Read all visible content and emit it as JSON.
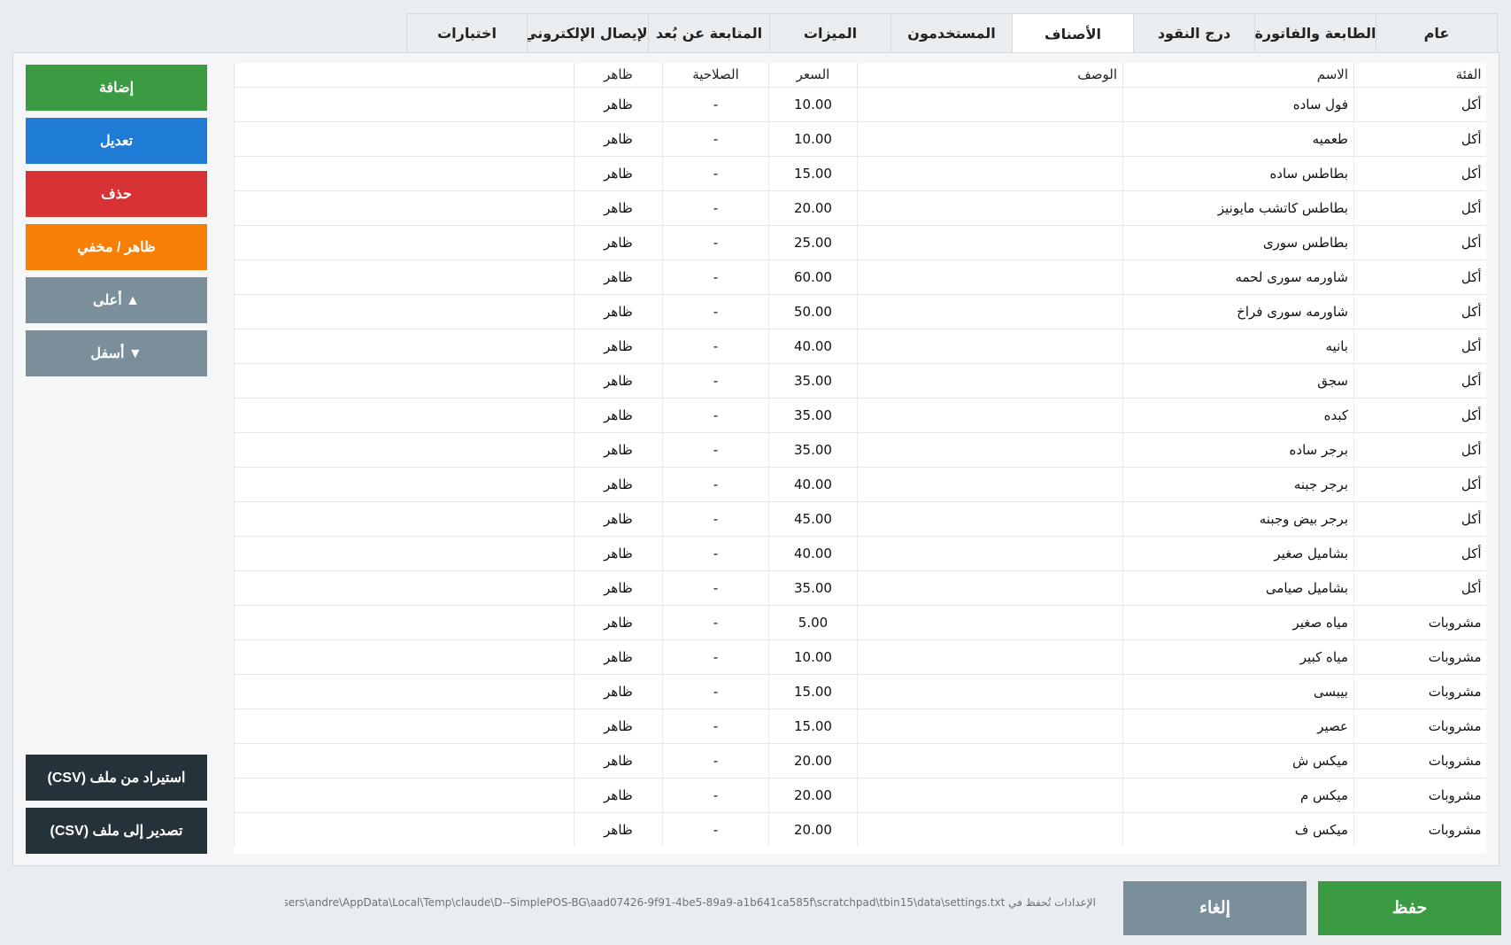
{
  "tabs": [
    {
      "label": "عام",
      "active": false
    },
    {
      "label": "الطابعة والفاتورة",
      "active": false
    },
    {
      "label": "درج النقود",
      "active": false
    },
    {
      "label": "الأصناف",
      "active": true
    },
    {
      "label": "المستخدمون",
      "active": false
    },
    {
      "label": "الميزات",
      "active": false
    },
    {
      "label": "المتابعة عن بُعد",
      "active": false
    },
    {
      "label": "الإيصال الإلكتروني",
      "active": false
    },
    {
      "label": "اختبارات",
      "active": false
    }
  ],
  "table": {
    "headers": {
      "category": "الفئة",
      "name": "الاسم",
      "description": "الوصف",
      "price": "السعر",
      "expiry": "الصلاحية",
      "visibility": "ظاهر"
    },
    "rows": [
      {
        "category": "أكل",
        "name": "فول ساده",
        "description": "",
        "price": "10.00",
        "expiry": "-",
        "visibility": "ظاهر"
      },
      {
        "category": "أكل",
        "name": "طعميه",
        "description": "",
        "price": "10.00",
        "expiry": "-",
        "visibility": "ظاهر"
      },
      {
        "category": "أكل",
        "name": "بطاطس ساده",
        "description": "",
        "price": "15.00",
        "expiry": "-",
        "visibility": "ظاهر"
      },
      {
        "category": "أكل",
        "name": "بطاطس كاتشب مايونيز",
        "description": "",
        "price": "20.00",
        "expiry": "-",
        "visibility": "ظاهر"
      },
      {
        "category": "أكل",
        "name": "بطاطس سورى",
        "description": "",
        "price": "25.00",
        "expiry": "-",
        "visibility": "ظاهر"
      },
      {
        "category": "أكل",
        "name": "شاورمه سورى لحمه",
        "description": "",
        "price": "60.00",
        "expiry": "-",
        "visibility": "ظاهر"
      },
      {
        "category": "أكل",
        "name": "شاورمه سورى فراخ",
        "description": "",
        "price": "50.00",
        "expiry": "-",
        "visibility": "ظاهر"
      },
      {
        "category": "أكل",
        "name": "بانيه",
        "description": "",
        "price": "40.00",
        "expiry": "-",
        "visibility": "ظاهر"
      },
      {
        "category": "أكل",
        "name": "سجق",
        "description": "",
        "price": "35.00",
        "expiry": "-",
        "visibility": "ظاهر"
      },
      {
        "category": "أكل",
        "name": "كبده",
        "description": "",
        "price": "35.00",
        "expiry": "-",
        "visibility": "ظاهر"
      },
      {
        "category": "أكل",
        "name": "برجر ساده",
        "description": "",
        "price": "35.00",
        "expiry": "-",
        "visibility": "ظاهر"
      },
      {
        "category": "أكل",
        "name": "برجر جبنه",
        "description": "",
        "price": "40.00",
        "expiry": "-",
        "visibility": "ظاهر"
      },
      {
        "category": "أكل",
        "name": "برجر بيض وجبنه",
        "description": "",
        "price": "45.00",
        "expiry": "-",
        "visibility": "ظاهر"
      },
      {
        "category": "أكل",
        "name": "بشاميل صغير",
        "description": "",
        "price": "40.00",
        "expiry": "-",
        "visibility": "ظاهر"
      },
      {
        "category": "أكل",
        "name": "بشاميل صيامى",
        "description": "",
        "price": "35.00",
        "expiry": "-",
        "visibility": "ظاهر"
      },
      {
        "category": "مشروبات",
        "name": "مياه صغير",
        "description": "",
        "price": "5.00",
        "expiry": "-",
        "visibility": "ظاهر"
      },
      {
        "category": "مشروبات",
        "name": "مياه كبير",
        "description": "",
        "price": "10.00",
        "expiry": "-",
        "visibility": "ظاهر"
      },
      {
        "category": "مشروبات",
        "name": "بيبسى",
        "description": "",
        "price": "15.00",
        "expiry": "-",
        "visibility": "ظاهر"
      },
      {
        "category": "مشروبات",
        "name": "عصير",
        "description": "",
        "price": "15.00",
        "expiry": "-",
        "visibility": "ظاهر"
      },
      {
        "category": "مشروبات",
        "name": "ميكس ش",
        "description": "",
        "price": "20.00",
        "expiry": "-",
        "visibility": "ظاهر"
      },
      {
        "category": "مشروبات",
        "name": "ميكس م",
        "description": "",
        "price": "20.00",
        "expiry": "-",
        "visibility": "ظاهر"
      },
      {
        "category": "مشروبات",
        "name": "ميكس ف",
        "description": "",
        "price": "20.00",
        "expiry": "-",
        "visibility": "ظاهر"
      }
    ]
  },
  "sidebar": {
    "add_label": "إضافة",
    "edit_label": "تعديل",
    "delete_label": "حذف",
    "toggle_visibility_label": "ظاهر / مخفي",
    "move_up_label": "▲ أعلى",
    "move_down_label": "▼ أسفل",
    "import_label": "استيراد من ملف (CSV)",
    "export_label": "تصدير إلى ملف (CSV)"
  },
  "footer": {
    "settings_path": "الإعدادات تُحفظ في C:\\Users\\andre\\AppData\\Local\\Temp\\claude\\D--SimplePOS-BG\\aad07426-9f91-4be5-89a9-a1b641ca585f\\scratchpad\\tbin15\\data\\settings.txt",
    "cancel_label": "إلغاء",
    "save_label": "حفظ"
  },
  "colors": {
    "add": "#3b9b42",
    "edit": "#1e7bd6",
    "delete": "#d93235",
    "visibility": "#f77f06",
    "move": "#7a8f9a",
    "csv": "#26323a",
    "save": "#3b9b42",
    "cancel": "#7a8f9a"
  }
}
